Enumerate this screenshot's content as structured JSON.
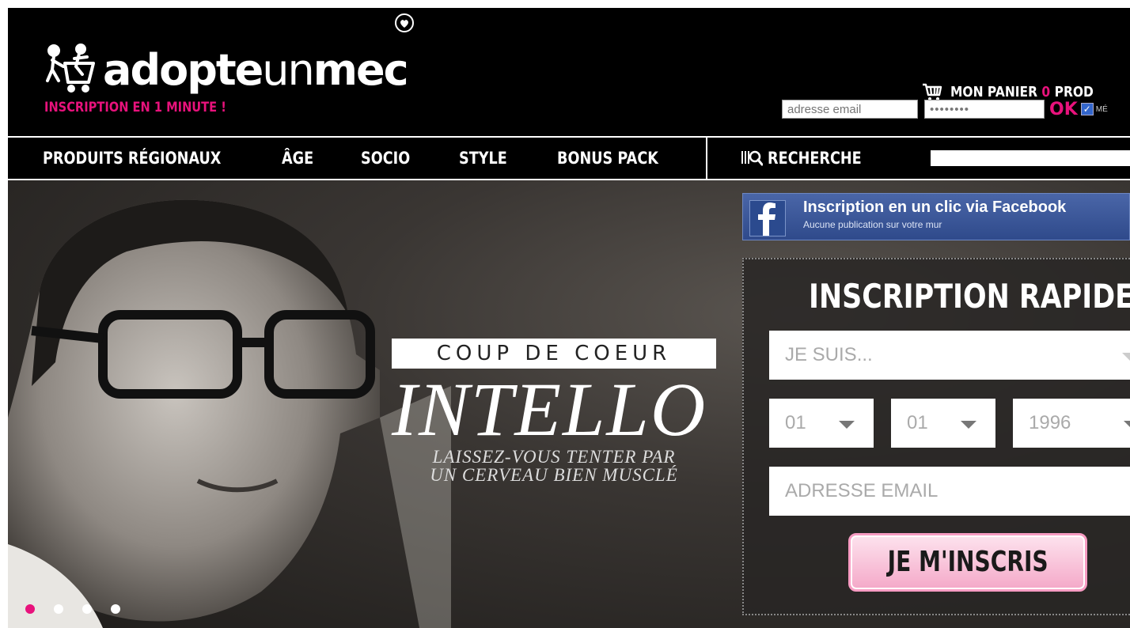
{
  "header": {
    "logo": {
      "bold_part": "adopte",
      "light_part": "un",
      "bold_part2": "mec"
    },
    "tagline": "INSCRIPTION EN 1 MINUTE !",
    "cart": {
      "label": "MON PANIER",
      "count": "0",
      "label_suffix": "PROD"
    },
    "login": {
      "email_placeholder": "adresse email",
      "password_value": "••••••••",
      "ok_label": "OK",
      "remember_label": "MÉ"
    }
  },
  "nav": {
    "items": [
      {
        "label": "PRODUITS RÉGIONAUX"
      },
      {
        "label": "ÂGE"
      },
      {
        "label": "SOCIO"
      },
      {
        "label": "STYLE"
      },
      {
        "label": "BONUS PACK"
      }
    ],
    "search_label": "RECHERCHE"
  },
  "hero": {
    "kicker": "COUP DE COEUR",
    "headline": "INTELLO",
    "subline_1": "LAISSEZ-VOUS TENTER PAR",
    "subline_2": "UN CERVEAU BIEN MUSCLÉ",
    "slides": {
      "count": 4,
      "active_index": 0
    }
  },
  "facebook": {
    "title": "Inscription en un clic via Facebook",
    "subtitle": "Aucune publication sur votre mur"
  },
  "signup": {
    "title": "INSCRIPTION RAPIDE",
    "gender_placeholder": "JE SUIS...",
    "day": "01",
    "month": "01",
    "year": "1996",
    "email_placeholder": "ADRESSE EMAIL",
    "submit_label": "JE M'INSCRIS"
  },
  "colors": {
    "brand_pink": "#e8127c",
    "facebook_blue": "#3b5998"
  }
}
